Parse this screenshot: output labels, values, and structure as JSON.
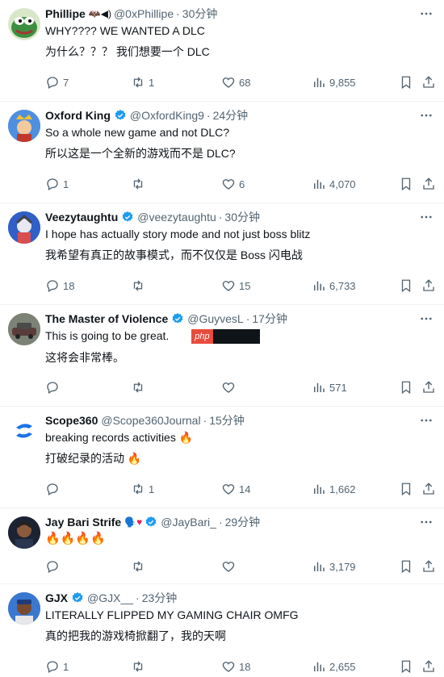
{
  "tweets": [
    {
      "name": "Phillipe",
      "handle": "@0xPhillipe",
      "time": "30分钟",
      "verified": false,
      "name_emoji": "🦇◀)",
      "text_en": "WHY???? WE WANTED A DLC",
      "text_zh": "为什么？？？ 我们想要一个 DLC",
      "replies": "7",
      "retweets": "1",
      "likes": "68",
      "views": "9,855",
      "avatar_color": "#2d7d46",
      "avatar_icon": "pepe-avatar"
    },
    {
      "name": "Oxford King",
      "handle": "@OxfordKing9",
      "time": "24分钟",
      "verified": true,
      "text_en": "So a whole new game and not DLC?",
      "text_zh": "所以这是一个全新的游戏而不是 DLC?",
      "replies": "1",
      "retweets": "",
      "likes": "6",
      "views": "4,070",
      "avatar_color": "#2a5aa8",
      "avatar_icon": "king-avatar"
    },
    {
      "name": "Veezytaughtu",
      "handle": "@veezytaughtu",
      "time": "30分钟",
      "verified": true,
      "text_en": "I hope has actually story mode and not just boss blitz",
      "text_zh": "我希望有真正的故事模式，而不仅仅是 Boss 闪电战",
      "replies": "18",
      "retweets": "",
      "likes": "15",
      "views": "6,733",
      "avatar_color": "#3b6fd6",
      "avatar_icon": "game-character-avatar"
    },
    {
      "name": "The Master of Violence",
      "handle": "@GuyvesL",
      "time": "17分钟",
      "verified": true,
      "text_en": "This is going to be great.",
      "text_zh": "这将会非常棒。",
      "watermark": "php",
      "replies": "",
      "retweets": "",
      "likes": "",
      "views": "571",
      "avatar_color": "#6b6f66",
      "avatar_icon": "car-avatar"
    },
    {
      "name": "Scope360",
      "handle": "@Scope360Journal",
      "time": "15分钟",
      "verified": false,
      "text_en": "breaking records activities 🔥",
      "text_zh": "打破纪录的活动 🔥",
      "replies": "",
      "retweets": "1",
      "likes": "14",
      "views": "1,662",
      "avatar_color": "#ffffff",
      "avatar_icon": "scope-logo-avatar"
    },
    {
      "name": "Jay Bari Strife",
      "handle": "@JayBari_",
      "time": "29分钟",
      "verified": true,
      "name_emoji": "🗣️♥",
      "text_en": "🔥🔥🔥🔥",
      "text_zh": "",
      "replies": "",
      "retweets": "",
      "likes": "",
      "views": "3,179",
      "avatar_color": "#1c2333",
      "avatar_icon": "person-avatar"
    },
    {
      "name": "GJX",
      "handle": "@GJX__",
      "time": "23分钟",
      "verified": true,
      "text_en": "LITERALLY FLIPPED MY GAMING CHAIR OMFG",
      "text_zh": "真的把我的游戏椅掀翻了，我的天啊",
      "replies": "1",
      "retweets": "",
      "likes": "18",
      "views": "2,655",
      "avatar_color": "#2f6dc4",
      "avatar_icon": "person-avatar"
    }
  ],
  "colors": {
    "verified": "#1d9bf0",
    "muted": "#536471",
    "text": "#0f1419",
    "divider": "#eff3f4"
  }
}
